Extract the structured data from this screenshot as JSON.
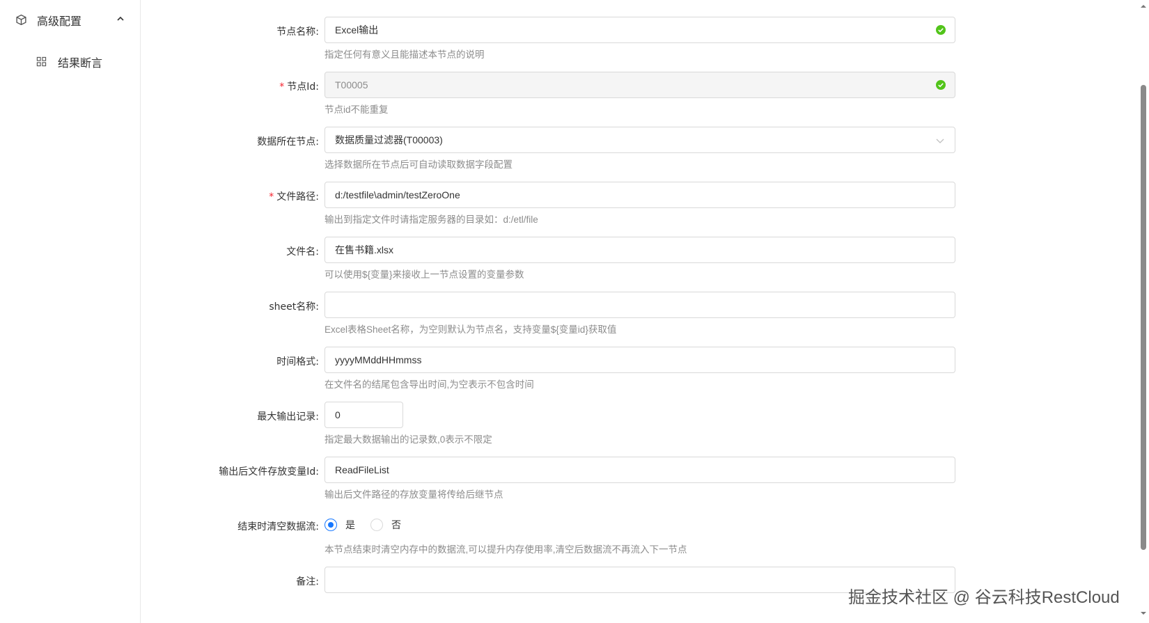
{
  "sidebar": {
    "group_label": "高级配置",
    "group_icon": "cube-icon",
    "group_expanded": true,
    "items": [
      {
        "label": "结果断言",
        "icon": "grid-icon"
      }
    ]
  },
  "form": {
    "node_name": {
      "label": "节点名称:",
      "value": "Excel输出",
      "help": "指定任何有意义且能描述本节点的说明"
    },
    "node_id": {
      "label": "节点Id:",
      "required": true,
      "value": "T00005",
      "help": "节点id不能重复"
    },
    "data_node": {
      "label": "数据所在节点:",
      "value": "数据质量过滤器(T00003)",
      "help": "选择数据所在节点后可自动读取数据字段配置"
    },
    "file_path": {
      "label": "文件路径:",
      "required": true,
      "value": "d:/testfile\\admin/testZeroOne",
      "help": "输出到指定文件时请指定服务器的目录如：d:/etl/file"
    },
    "file_name": {
      "label": "文件名:",
      "value": "在售书籍.xlsx",
      "help": "可以使用${变量}来接收上一节点设置的变量参数"
    },
    "sheet_name": {
      "label": "sheet名称:",
      "value": "",
      "help": "Excel表格Sheet名称，为空则默认为节点名，支持变量${变量id}获取值"
    },
    "time_format": {
      "label": "时间格式:",
      "value": "yyyyMMddHHmmss",
      "help": "在文件名的结尾包含导出时间,为空表示不包含时间"
    },
    "max_records": {
      "label": "最大输出记录:",
      "value": "0",
      "help": "指定最大数据输出的记录数,0表示不限定"
    },
    "output_var": {
      "label": "输出后文件存放变量Id:",
      "value": "ReadFileList",
      "help": "输出后文件路径的存放变量将传给后继节点"
    },
    "clear_stream": {
      "label": "结束时清空数据流:",
      "options": [
        "是",
        "否"
      ],
      "selected": "是",
      "help": "本节点结束时清空内存中的数据流,可以提升内存使用率,清空后数据流不再流入下一节点"
    },
    "remark": {
      "label": "备注:",
      "value": ""
    }
  },
  "watermark": "掘金技术社区 @ 谷云科技RestCloud",
  "colors": {
    "primary": "#1677ff",
    "success": "#52c41a",
    "required": "#f5222d",
    "help_text": "#8c8c8c"
  }
}
